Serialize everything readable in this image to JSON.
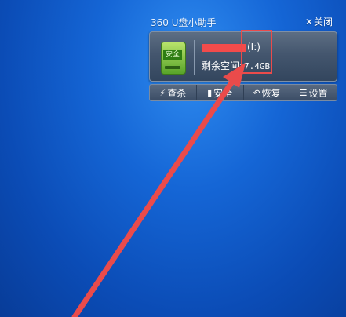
{
  "widget": {
    "title": "360 U盘小助手",
    "close_label": "关闭",
    "drive_badge": "安全",
    "drive_letter": "(I:)",
    "free_space_label": "剩余空间:",
    "free_space_value": "7.4GB"
  },
  "toolbar": {
    "items": [
      {
        "icon": "lightning-icon",
        "label": "查杀"
      },
      {
        "icon": "usb-icon",
        "label": "安全"
      },
      {
        "icon": "restore-icon",
        "label": "恢复"
      },
      {
        "icon": "list-icon",
        "label": "设置"
      }
    ]
  },
  "colors": {
    "annotation": "#ea4b4b",
    "desktop": "#1566d6"
  }
}
